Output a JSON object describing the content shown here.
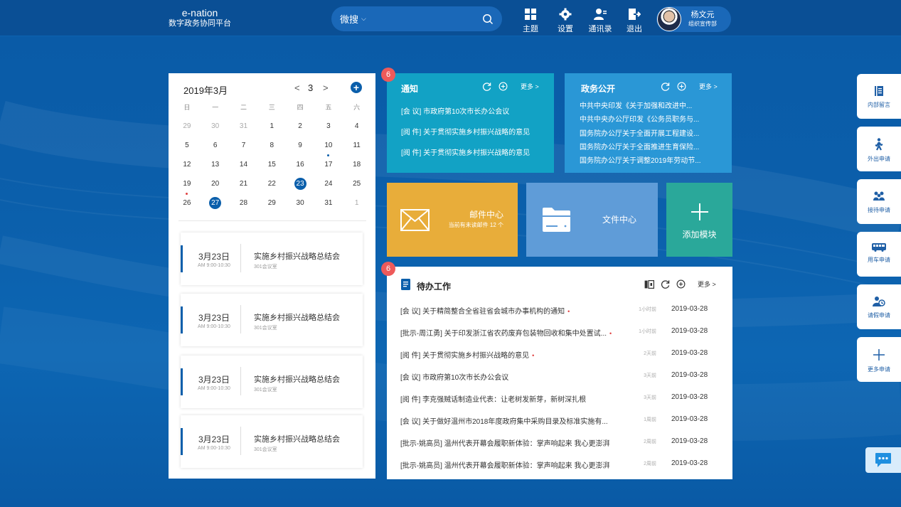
{
  "header": {
    "logo_en": "e-nation",
    "logo_cn": "数字政务协同平台",
    "search_scope": "微搜",
    "nav": [
      {
        "label": "主题",
        "icon": "grid-icon"
      },
      {
        "label": "设置",
        "icon": "gear-icon"
      },
      {
        "label": "通讯录",
        "icon": "contacts-icon"
      },
      {
        "label": "退出",
        "icon": "logout-icon"
      }
    ],
    "user": {
      "name": "杨文元",
      "dept": "组织宣传部"
    }
  },
  "calendar": {
    "title": "2019年3月",
    "month": "3",
    "weekdays": [
      "日",
      "一",
      "二",
      "三",
      "四",
      "五",
      "六"
    ],
    "weeks": [
      [
        "29",
        "30",
        "31",
        "1",
        "2",
        "3",
        "4"
      ],
      [
        "5",
        "6",
        "7",
        "8",
        "9",
        "10",
        "11"
      ],
      [
        "12",
        "13",
        "14",
        "15",
        "16",
        "17",
        "18"
      ],
      [
        "19",
        "20",
        "21",
        "22",
        "23",
        "24",
        "25"
      ],
      [
        "26",
        "27",
        "28",
        "29",
        "30",
        "31",
        "1"
      ]
    ],
    "highlighted": {
      "today": "23",
      "selected": "27"
    },
    "events": [
      {
        "date": "3月23日",
        "time": "AM 9:00-10:30",
        "title": "实施乡村振兴战略总结会",
        "room": "301会议室"
      },
      {
        "date": "3月23日",
        "time": "AM 9:00-10:30",
        "title": "实施乡村振兴战略总结会",
        "room": "301会议室"
      },
      {
        "date": "3月23日",
        "time": "AM 9:00-10:30",
        "title": "实施乡村振兴战略总结会",
        "room": "301会议室"
      },
      {
        "date": "3月23日",
        "time": "AM 9:00-10:30",
        "title": "实施乡村振兴战略总结会",
        "room": "301会议室"
      }
    ]
  },
  "notice": {
    "badge": "6",
    "title": "通知",
    "more": "更多 >",
    "items": [
      "[会 议] 市政府第10次市长办公会议",
      "[阅 件] 关于贯彻实施乡村振兴战略的意见",
      "[阅 件] 关于贯彻实施乡村振兴战略的意见"
    ]
  },
  "gov": {
    "title": "政务公开",
    "more": "更多 >",
    "items": [
      "中共中央印发《关于加强和改进中...",
      "中共中央办公厅印发《公务员职务与...",
      "国务院办公厅关于全面开展工程建设...",
      "国务院办公厅关于全面推进生育保险...",
      "国务院办公厅关于调整2019年劳动节..."
    ]
  },
  "tiles": {
    "mail": {
      "title": "邮件中心",
      "sub": "当前有未读邮件 12 个"
    },
    "file": {
      "title": "文件中心"
    },
    "add": {
      "title": "添加模块"
    }
  },
  "todo": {
    "badge": "6",
    "title": "待办工作",
    "more": "更多 >",
    "rows": [
      {
        "text": "[会 议] 关于精简整合全省驻省会城市办事机构的通知",
        "urgent": true,
        "ago": "1小时前",
        "date": "2019-03-28"
      },
      {
        "text": "[批示-周江勇] 关于印发浙江省农药废弃包装物回收和集中处置试...",
        "urgent": true,
        "ago": "1小时前",
        "date": "2019-03-28"
      },
      {
        "text": "[阅 件] 关于贯彻实施乡村振兴战略的意见",
        "urgent": true,
        "ago": "2天前",
        "date": "2019-03-28"
      },
      {
        "text": "[会 议] 市政府第10次市长办公会议",
        "urgent": false,
        "ago": "3天前",
        "date": "2019-03-28"
      },
      {
        "text": "[阅 件] 李克强贼话制造业代表：让老树发新芽，新树深扎根",
        "urgent": false,
        "ago": "3天前",
        "date": "2019-03-28"
      },
      {
        "text": "[会 议] 关于做好温州市2018年度政府集中采购目录及标准实施有...",
        "urgent": false,
        "ago": "1周前",
        "date": "2019-03-28"
      },
      {
        "text": "[批示-姚高员] 温州代表开幕会履职新体验：掌声响起来 我心更澎湃",
        "urgent": false,
        "ago": "2周前",
        "date": "2019-03-28"
      },
      {
        "text": "[批示-姚高员] 温州代表开幕会履职新体验：掌声响起来 我心更澎湃",
        "urgent": false,
        "ago": "2周前",
        "date": "2019-03-28"
      }
    ]
  },
  "sidebar": [
    {
      "label": "内部留言",
      "icon": "notebook-icon"
    },
    {
      "label": "外出申请",
      "icon": "walking-person-icon"
    },
    {
      "label": "接待申请",
      "icon": "group-icon"
    },
    {
      "label": "用车申请",
      "icon": "bus-icon"
    },
    {
      "label": "请假申请",
      "icon": "leave-person-icon"
    },
    {
      "label": "更多申请",
      "icon": "plus-icon"
    }
  ],
  "colors": {
    "primary": "#0b5fab",
    "notice_bg": "#12a2c5",
    "gov_bg": "#2a97d6",
    "mail_bg": "#e8ad3a",
    "file_bg": "#5f9cd8",
    "add_bg": "#2aa89a",
    "badge": "#ee5a5a"
  }
}
